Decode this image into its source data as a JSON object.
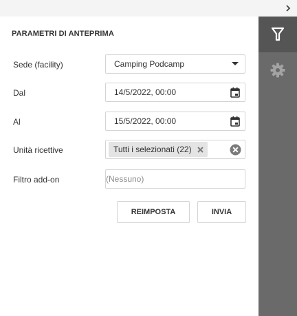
{
  "panel": {
    "title": "PARAMETRI DI ANTEPRIMA"
  },
  "fields": {
    "sede": {
      "label": "Sede (facility)",
      "value": "Camping Podcamp"
    },
    "dal": {
      "label": "Dal",
      "value": "14/5/2022, 00:00"
    },
    "al": {
      "label": "Al",
      "value": "15/5/2022, 00:00"
    },
    "unita": {
      "label": "Unità ricettive",
      "tag": "Tutti i selezionati (22)"
    },
    "filtro": {
      "label": "Filtro add-on",
      "placeholder": "(Nessuno)"
    }
  },
  "buttons": {
    "reset": "REIMPOSTA",
    "submit": "INVIA"
  },
  "icons": {
    "collapse": "chevron-right-icon",
    "filter": "filter-icon",
    "settings": "gear-icon",
    "dropdown": "caret-down-icon",
    "calendar": "calendar-icon",
    "tag_remove": "close-icon",
    "clear": "clear-circle-icon"
  },
  "colors": {
    "sidebar": "#6a6a6a",
    "sidebar_active": "#555555",
    "border": "#d4d4d4",
    "tag_bg": "#e4e4e4"
  }
}
